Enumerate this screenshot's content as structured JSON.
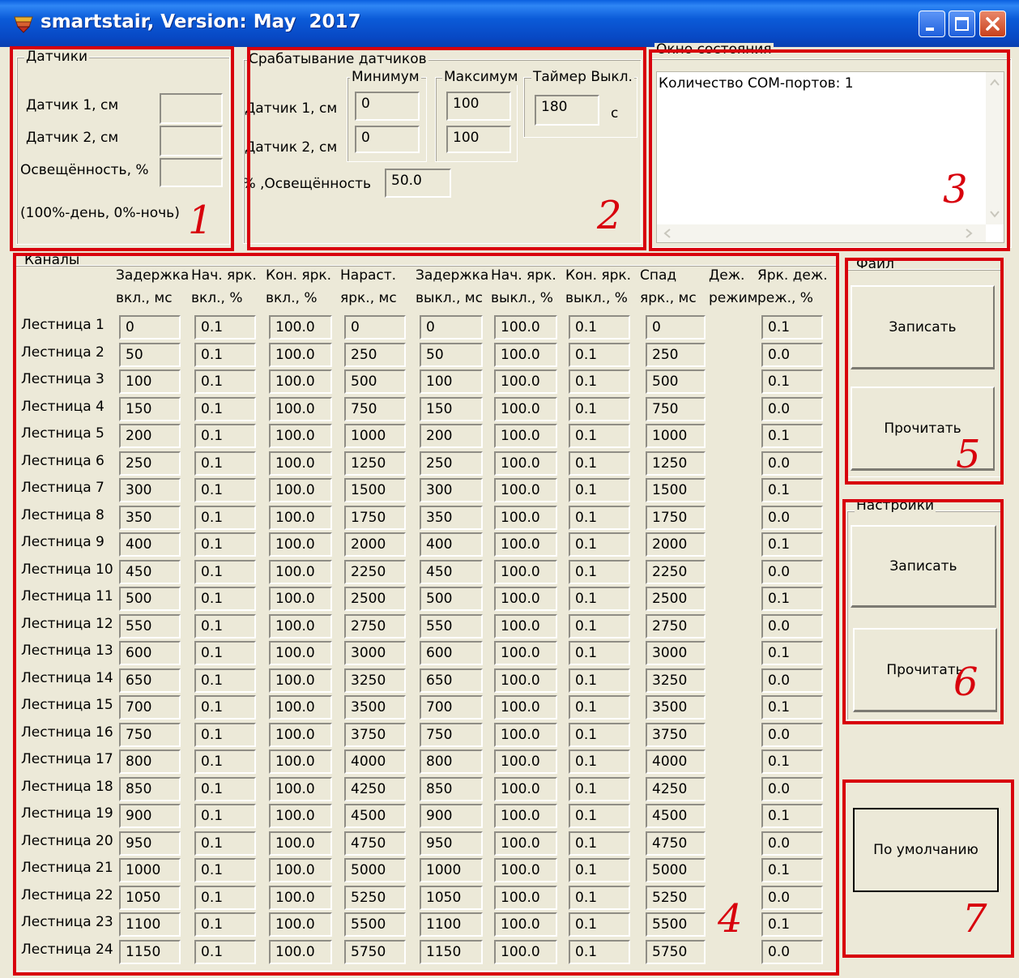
{
  "window": {
    "title": "smartstair, Version: May  2017"
  },
  "sensors": {
    "group_title": "Датчики",
    "sensor1_label": "Датчик 1, см",
    "sensor1_value": "",
    "sensor2_label": "Датчик 2, см",
    "sensor2_value": "",
    "light_label": "Освещённость, %",
    "light_value": "",
    "note": "(100%-день, 0%-ночь)"
  },
  "trigger": {
    "group_title": "Срабатывание датчиков",
    "min_title": "Минимум",
    "max_title": "Максимум",
    "timer_title": "Таймер Выкл.",
    "sensor1_label": "Датчик 1, см",
    "sensor2_label": "Датчик 2, см",
    "sensor1_min": "0",
    "sensor2_min": "0",
    "sensor1_max": "100",
    "sensor2_max": "100",
    "timer_value": "180",
    "timer_unit": "с",
    "light_label": "Освещённость, %",
    "light_value": "50.0"
  },
  "status": {
    "group_title": "Окно состояния",
    "text": "Количество COM-портов: 1"
  },
  "channels": {
    "group_title": "Каналы",
    "headers": [
      [
        "Задержка",
        "вкл., мс"
      ],
      [
        "Нач. ярк.",
        "вкл., %"
      ],
      [
        "Кон. ярк.",
        "вкл., %"
      ],
      [
        "Нараст.",
        "ярк., мс"
      ],
      [
        "Задержка",
        "выкл., мс"
      ],
      [
        "Нач. ярк.",
        "выкл., %"
      ],
      [
        "Кон. ярк.",
        "выкл., %"
      ],
      [
        "Спад",
        "ярк., мс"
      ],
      [
        "Деж.",
        "режим"
      ],
      [
        "Ярк. деж.",
        "реж., %"
      ]
    ],
    "rows": [
      {
        "label": "Лестница 1",
        "values": [
          "0",
          "0.1",
          "100.0",
          "0",
          "0",
          "100.0",
          "0.1",
          "0",
          "0.1"
        ]
      },
      {
        "label": "Лестница 2",
        "values": [
          "50",
          "0.1",
          "100.0",
          "250",
          "50",
          "100.0",
          "0.1",
          "250",
          "0.0"
        ]
      },
      {
        "label": "Лестница 3",
        "values": [
          "100",
          "0.1",
          "100.0",
          "500",
          "100",
          "100.0",
          "0.1",
          "500",
          "0.1"
        ]
      },
      {
        "label": "Лестница 4",
        "values": [
          "150",
          "0.1",
          "100.0",
          "750",
          "150",
          "100.0",
          "0.1",
          "750",
          "0.0"
        ]
      },
      {
        "label": "Лестница 5",
        "values": [
          "200",
          "0.1",
          "100.0",
          "1000",
          "200",
          "100.0",
          "0.1",
          "1000",
          "0.1"
        ]
      },
      {
        "label": "Лестница 6",
        "values": [
          "250",
          "0.1",
          "100.0",
          "1250",
          "250",
          "100.0",
          "0.1",
          "1250",
          "0.0"
        ]
      },
      {
        "label": "Лестница 7",
        "values": [
          "300",
          "0.1",
          "100.0",
          "1500",
          "300",
          "100.0",
          "0.1",
          "1500",
          "0.1"
        ]
      },
      {
        "label": "Лестница 8",
        "values": [
          "350",
          "0.1",
          "100.0",
          "1750",
          "350",
          "100.0",
          "0.1",
          "1750",
          "0.0"
        ]
      },
      {
        "label": "Лестница 9",
        "values": [
          "400",
          "0.1",
          "100.0",
          "2000",
          "400",
          "100.0",
          "0.1",
          "2000",
          "0.1"
        ]
      },
      {
        "label": "Лестница 10",
        "values": [
          "450",
          "0.1",
          "100.0",
          "2250",
          "450",
          "100.0",
          "0.1",
          "2250",
          "0.0"
        ]
      },
      {
        "label": "Лестница 11",
        "values": [
          "500",
          "0.1",
          "100.0",
          "2500",
          "500",
          "100.0",
          "0.1",
          "2500",
          "0.1"
        ]
      },
      {
        "label": "Лестница 12",
        "values": [
          "550",
          "0.1",
          "100.0",
          "2750",
          "550",
          "100.0",
          "0.1",
          "2750",
          "0.0"
        ]
      },
      {
        "label": "Лестница 13",
        "values": [
          "600",
          "0.1",
          "100.0",
          "3000",
          "600",
          "100.0",
          "0.1",
          "3000",
          "0.1"
        ]
      },
      {
        "label": "Лестница 14",
        "values": [
          "650",
          "0.1",
          "100.0",
          "3250",
          "650",
          "100.0",
          "0.1",
          "3250",
          "0.0"
        ]
      },
      {
        "label": "Лестница 15",
        "values": [
          "700",
          "0.1",
          "100.0",
          "3500",
          "700",
          "100.0",
          "0.1",
          "3500",
          "0.1"
        ]
      },
      {
        "label": "Лестница 16",
        "values": [
          "750",
          "0.1",
          "100.0",
          "3750",
          "750",
          "100.0",
          "0.1",
          "3750",
          "0.0"
        ]
      },
      {
        "label": "Лестница 17",
        "values": [
          "800",
          "0.1",
          "100.0",
          "4000",
          "800",
          "100.0",
          "0.1",
          "4000",
          "0.1"
        ]
      },
      {
        "label": "Лестница 18",
        "values": [
          "850",
          "0.1",
          "100.0",
          "4250",
          "850",
          "100.0",
          "0.1",
          "4250",
          "0.0"
        ]
      },
      {
        "label": "Лестница 19",
        "values": [
          "900",
          "0.1",
          "100.0",
          "4500",
          "900",
          "100.0",
          "0.1",
          "4500",
          "0.1"
        ]
      },
      {
        "label": "Лестница 20",
        "values": [
          "950",
          "0.1",
          "100.0",
          "4750",
          "950",
          "100.0",
          "0.1",
          "4750",
          "0.0"
        ]
      },
      {
        "label": "Лестница 21",
        "values": [
          "1000",
          "0.1",
          "100.0",
          "5000",
          "1000",
          "100.0",
          "0.1",
          "5000",
          "0.1"
        ]
      },
      {
        "label": "Лестница 22",
        "values": [
          "1050",
          "0.1",
          "100.0",
          "5250",
          "1050",
          "100.0",
          "0.1",
          "5250",
          "0.0"
        ]
      },
      {
        "label": "Лестница 23",
        "values": [
          "1100",
          "0.1",
          "100.0",
          "5500",
          "1100",
          "100.0",
          "0.1",
          "5500",
          "0.1"
        ]
      },
      {
        "label": "Лестница 24",
        "values": [
          "1150",
          "0.1",
          "100.0",
          "5750",
          "1150",
          "100.0",
          "0.1",
          "5750",
          "0.0"
        ]
      }
    ]
  },
  "file": {
    "group_title": "Файл",
    "write_label": "Записать",
    "read_label": "Прочитать"
  },
  "settings": {
    "group_title": "Настройки",
    "write_label": "Записать",
    "read_label": "Прочитать"
  },
  "default_button": {
    "label": "По умолчанию"
  },
  "annotations": [
    "1",
    "2",
    "3",
    "4",
    "5",
    "6",
    "7"
  ],
  "colors": {
    "annotation": "#d8000c",
    "titlebar": "#0b5bd8",
    "window_bg": "#ece9d8"
  },
  "icons": [
    "app-icon",
    "minimize-icon",
    "maximize-icon",
    "close-icon",
    "scroll-up-icon",
    "scroll-down-icon",
    "scroll-left-icon",
    "scroll-right-icon"
  ]
}
